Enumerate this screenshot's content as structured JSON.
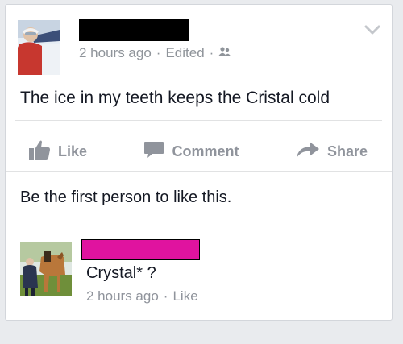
{
  "post": {
    "time": "2 hours ago",
    "dot1": "·",
    "edited": "Edited",
    "dot2": "·",
    "text": "The ice in my teeth keeps the Cristal cold"
  },
  "actions": {
    "like": "Like",
    "comment": "Comment",
    "share": "Share"
  },
  "likes_summary": "Be the first person to like this.",
  "comment": {
    "text": "Crystal* ?",
    "time": "2 hours ago",
    "dot": "·",
    "like": "Like"
  },
  "icons": {
    "privacy": "friends-icon",
    "options": "chevron-down-icon",
    "like": "thumbs-up-icon",
    "comment": "speech-bubble-icon",
    "share": "share-arrow-icon"
  },
  "colors": {
    "redact_name": "#000000",
    "redact_commenter": "#e0139f",
    "muted_text": "#90949c"
  }
}
